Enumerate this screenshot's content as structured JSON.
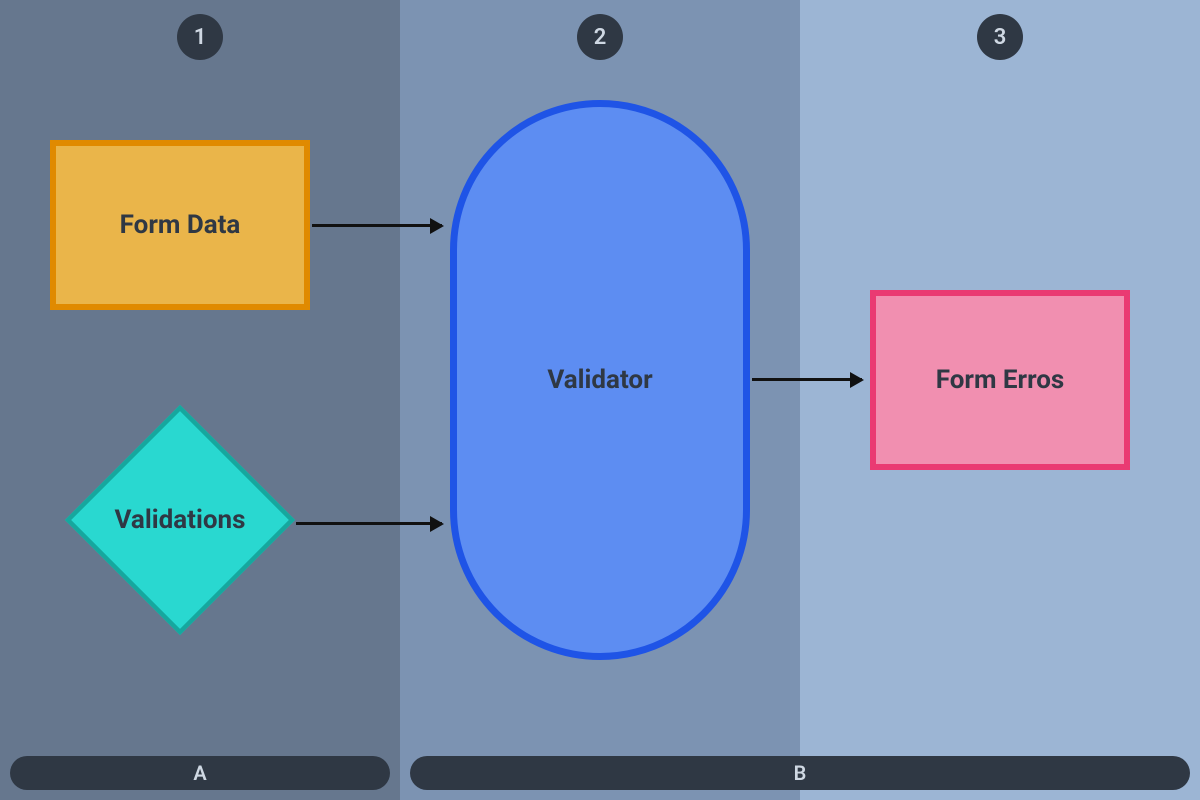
{
  "columns": {
    "col1_badge": "1",
    "col2_badge": "2",
    "col3_badge": "3"
  },
  "nodes": {
    "form_data": "Form Data",
    "validations": "Validations",
    "validator": "Validator",
    "form_errors": "Form Erros"
  },
  "regions": {
    "a": "A",
    "b": "B"
  },
  "colors": {
    "col1_bg": "#66778e",
    "col2_bg": "#7c93b2",
    "col3_bg": "#9cb5d4",
    "badge_bg": "#2f3844",
    "form_data_fill": "#eab54a",
    "form_data_border": "#e08a00",
    "validations_fill": "#29d8d0",
    "validations_border": "#16a79e",
    "validator_fill": "#5d8df2",
    "validator_border": "#1f54e6",
    "form_errors_fill": "#f18fb0",
    "form_errors_border": "#ea3a72"
  }
}
